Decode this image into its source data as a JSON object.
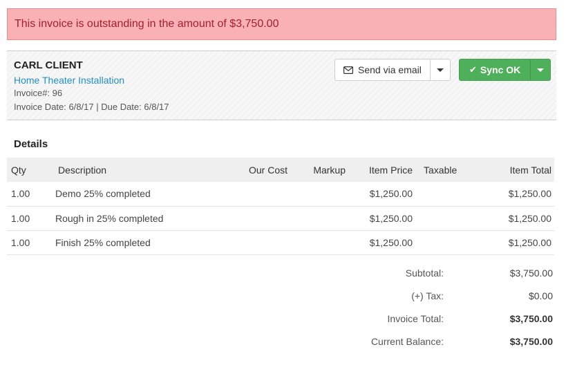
{
  "alert": {
    "message": "This invoice is outstanding in the amount of $3,750.00"
  },
  "header": {
    "client_name": "CARL CLIENT",
    "project": "Home Theater Installation",
    "invoice_number": "Invoice#: 96",
    "dates": "Invoice Date: 6/8/17 | Due Date: 6/8/17",
    "send_label": "Send via email",
    "sync_label": "Sync OK"
  },
  "details": {
    "title": "Details",
    "columns": [
      "Qty",
      "Description",
      "Our Cost",
      "Markup",
      "Item Price",
      "Taxable",
      "Item Total"
    ],
    "rows": [
      {
        "qty": "1.00",
        "description": "Demo 25% completed",
        "our_cost": "",
        "markup": "",
        "item_price": "$1,250.00",
        "taxable": "",
        "item_total": "$1,250.00"
      },
      {
        "qty": "1.00",
        "description": "Rough in 25% completed",
        "our_cost": "",
        "markup": "",
        "item_price": "$1,250.00",
        "taxable": "",
        "item_total": "$1,250.00"
      },
      {
        "qty": "1.00",
        "description": "Finish 25% completed",
        "our_cost": "",
        "markup": "",
        "item_price": "$1,250.00",
        "taxable": "",
        "item_total": "$1,250.00"
      }
    ]
  },
  "totals": {
    "subtotal_label": "Subtotal:",
    "subtotal": "$3,750.00",
    "tax_label": "(+) Tax:",
    "tax": "$0.00",
    "invoice_total_label": "Invoice Total:",
    "invoice_total": "$3,750.00",
    "balance_label": "Current Balance:",
    "balance": "$3,750.00"
  },
  "colors": {
    "alert_bg": "#f9b1b6",
    "alert_text": "#a31f2a",
    "link": "#1f8fc8",
    "sync_green": "#4fb05b"
  },
  "icons": {
    "send": "envelope-icon",
    "sync": "check-icon",
    "dropdown": "caret-down-icon"
  }
}
